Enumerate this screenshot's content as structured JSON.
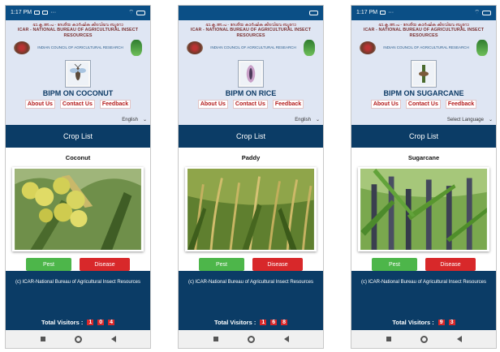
{
  "phones": [
    {
      "status_time": "1:17 PM",
      "hindi_line": "ഭാ.കൃ.അ.പ - ദേശീയ കാർഷിക കീടവിഭവ ബ്യൂറോ",
      "org_name": "ICAR - NATIONAL BUREAU OF AGRICULTURAL INSECT RESOURCES",
      "parent_org": "INDIAN COUNCIL OF AGRICULTURAL RESEARCH",
      "app_title": "BIPM ON COCONUT",
      "nav": [
        "About Us",
        "Contact Us",
        "Feedback"
      ],
      "language": "English",
      "crop_list_label": "Crop List",
      "crop_name": "Coconut",
      "pest_label": "Pest",
      "disease_label": "Disease",
      "copyright": "(c) ICAR-National Bureau of Agricultural Insect Resources",
      "visitors_label": "Total Visitors :",
      "visitors_digits": [
        "1",
        "0",
        "4"
      ]
    },
    {
      "status_time": "",
      "hindi_line": "ഭാ.കൃ.അ.പ - ദേശീയ കാർഷിക കീടവിഭവ ബ്യൂറോ",
      "org_name": "ICAR - NATIONAL BUREAU OF AGRICULTURAL INSECT RESOURCES",
      "parent_org": "INDIAN COUNCIL OF AGRICULTURAL RESEARCH",
      "app_title": "BIPM ON RICE",
      "nav": [
        "About Us",
        "Contact Us",
        "Feedback"
      ],
      "language": "English",
      "crop_list_label": "Crop List",
      "crop_name": "Paddy",
      "pest_label": "Pest",
      "disease_label": "Disease",
      "copyright": "(c) ICAR-National Bureau of Agricultural Insect Resources",
      "visitors_label": "Total Visitors :",
      "visitors_digits": [
        "1",
        "6",
        "8"
      ]
    },
    {
      "status_time": "1:17 PM",
      "hindi_line": "ഭാ.കൃ.അ.പ - ദേശീയ കാർഷിക കീടവിഭവ ബ്യൂറോ",
      "org_name": "ICAR - NATIONAL BUREAU OF AGRICULTURAL INSECT RESOURCES",
      "parent_org": "INDIAN COUNCIL OF AGRICULTURAL RESEARCH",
      "app_title": "BIPM ON SUGARCANE",
      "nav": [
        "About Us",
        "Contact Us",
        "Feedback"
      ],
      "language": "Select Language",
      "crop_list_label": "Crop List",
      "crop_name": "Sugarcane",
      "pest_label": "Pest",
      "disease_label": "Disease",
      "copyright": "(c) ICAR-National Bureau of Agricultural Insect Resources",
      "visitors_label": "Total Visitors :",
      "visitors_digits": [
        "9",
        "3"
      ]
    }
  ],
  "colors": {
    "status_bar": "#0b4f86",
    "header_bg": "#dfe6f3",
    "crop_bar": "#0b3c66",
    "pest_button": "#4db64a",
    "disease_button": "#d8282a",
    "nav_text": "#b31b1b"
  },
  "icons": {
    "status_left": [
      "message-icon",
      "image-icon",
      "more-icon"
    ],
    "status_right": [
      "wifi-icon",
      "signal-icon",
      "battery-icon"
    ],
    "nav_bar": [
      "recent-apps-icon",
      "home-icon",
      "back-icon"
    ],
    "dropdown": "chevron-down-icon"
  }
}
